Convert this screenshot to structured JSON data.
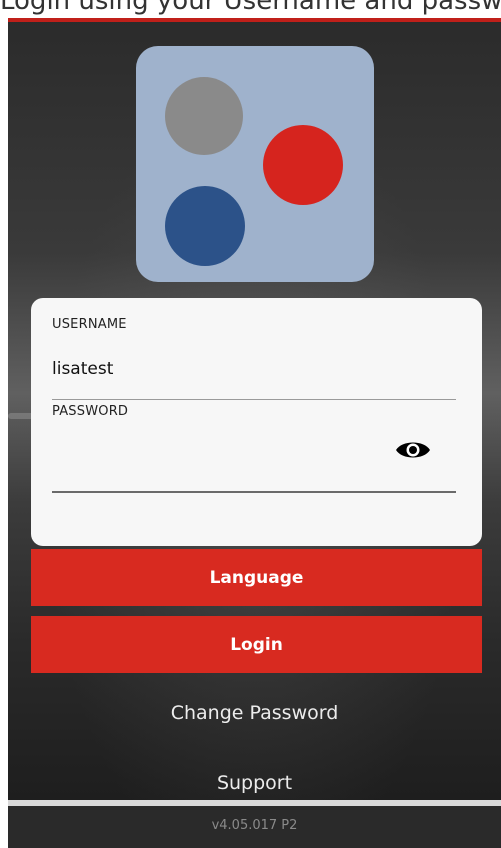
{
  "top_caption": "Login using your Username and password",
  "logo": {
    "name": "app-logo",
    "colors": {
      "tile": "#9fb2cc",
      "gray": "#8a8a8a",
      "red": "#d6241e",
      "blue": "#2c5289"
    }
  },
  "form": {
    "username_label": "USERNAME",
    "username_value": "lisatest",
    "password_label": "PASSWORD",
    "password_value": "",
    "eye_icon": "eye-icon"
  },
  "buttons": {
    "language": "Language",
    "login": "Login"
  },
  "links": {
    "change_password": "Change Password",
    "support": "Support"
  },
  "footer": {
    "version": "v4.05.017 P2"
  },
  "colors": {
    "accent": "#d82a20",
    "card": "#f7f7f7"
  }
}
